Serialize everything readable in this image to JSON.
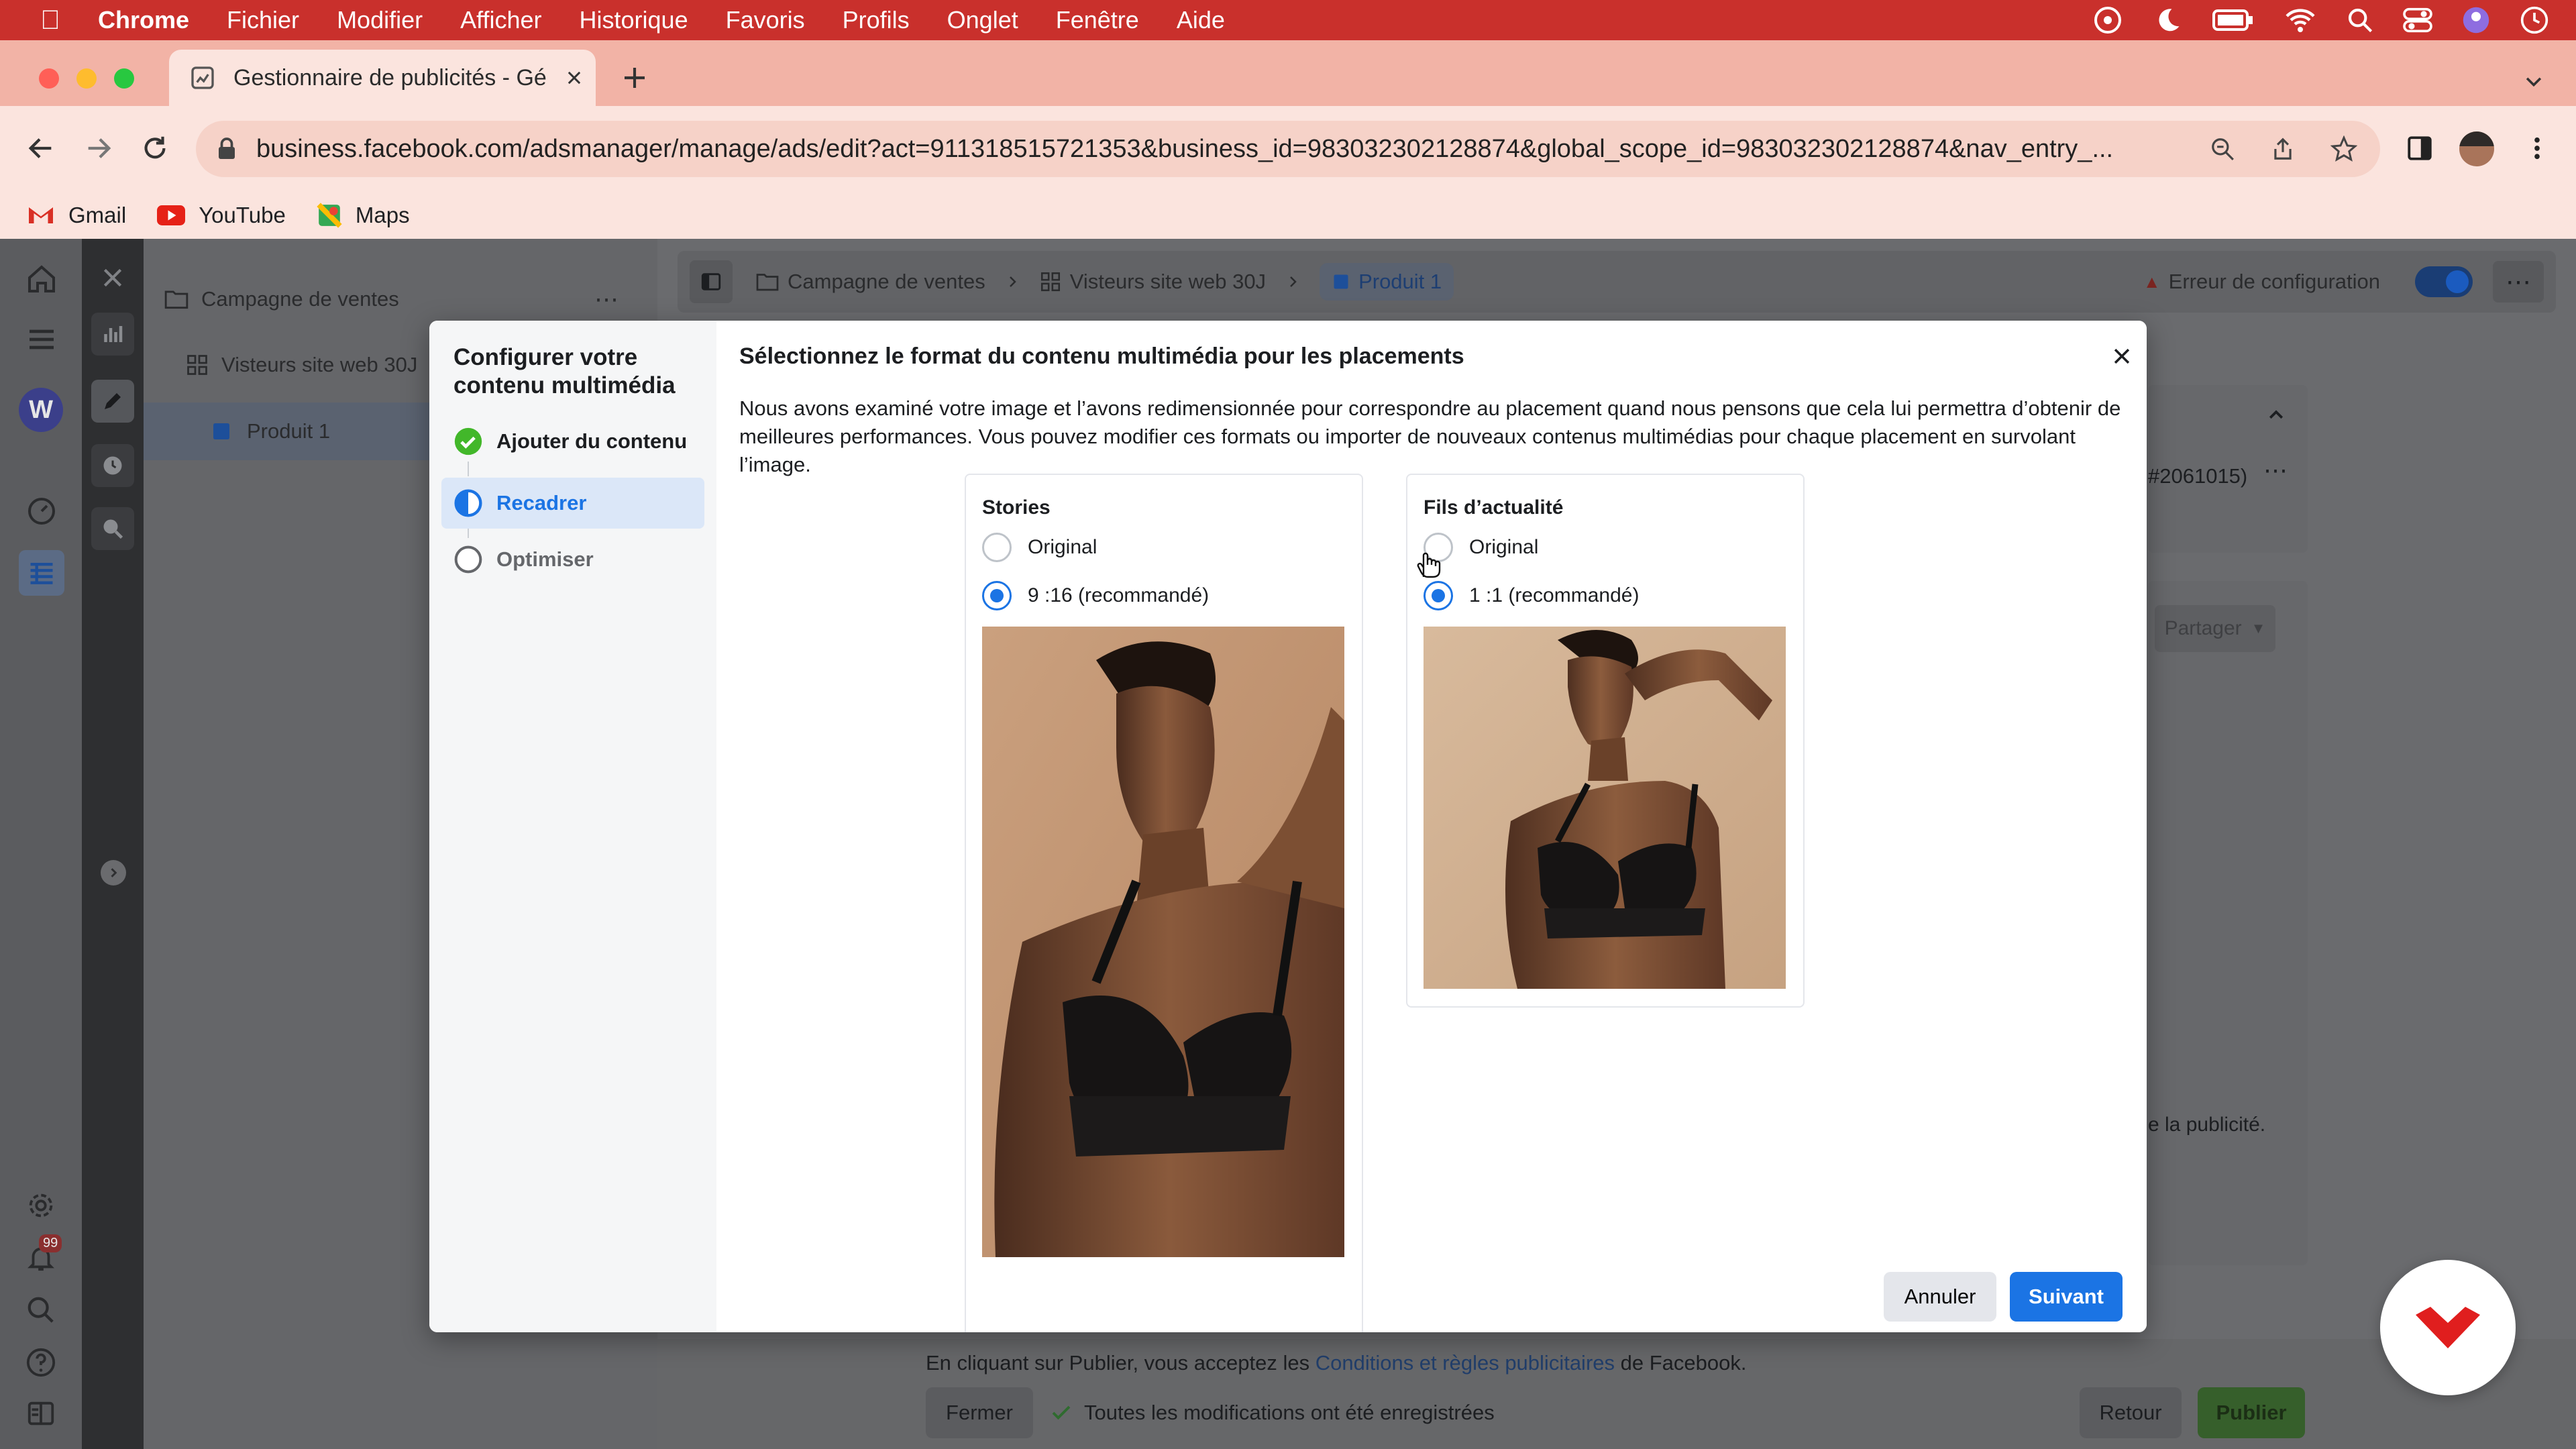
{
  "menubar": {
    "app": "Chrome",
    "items": [
      "Fichier",
      "Modifier",
      "Afficher",
      "Historique",
      "Favoris",
      "Profils",
      "Onglet",
      "Fenêtre",
      "Aide"
    ]
  },
  "browser": {
    "tab_title": "Gestionnaire de publicités - Gé",
    "url": "business.facebook.com/adsmanager/manage/ads/edit?act=911318515721353&business_id=983032302128874&global_scope_id=983032302128874&nav_entry_...",
    "bookmarks": [
      "Gmail",
      "YouTube",
      "Maps"
    ]
  },
  "tree": {
    "campaign": "Campagne de ventes",
    "adset": "Visteurs site web 30J",
    "ad": "Produit 1"
  },
  "breadcrumb": {
    "campaign": "Campagne de ventes",
    "adset": "Visteurs site web 30J",
    "ad": "Produit 1"
  },
  "status": {
    "error": "Erreur de configuration"
  },
  "background": {
    "id_fragment": "#2061015)",
    "share": "Partager",
    "note_fragment": "e la publicité.",
    "notification_count": "99"
  },
  "modal": {
    "sidebar_title": "Configurer votre contenu multimédia",
    "steps": [
      {
        "label": "Ajouter du contenu",
        "state": "done"
      },
      {
        "label": "Recadrer",
        "state": "current"
      },
      {
        "label": "Optimiser",
        "state": "todo"
      }
    ],
    "title": "Sélectionnez le format du contenu multimédia pour les placements",
    "description": "Nous avons examiné votre image et l’avons redimensionnée pour correspondre au placement quand nous pensons que cela lui permettra d’obtenir de meilleures performances. Vous pouvez modifier ces formats ou importer de nouveaux contenus multimédias pour chaque placement en survolant l’image.",
    "placements": [
      {
        "title": "Stories",
        "options": [
          "Original",
          "9 :16 (recommandé)"
        ],
        "selected": 1
      },
      {
        "title": "Fils d’actualité",
        "options": [
          "Original",
          "1 :1 (recommandé)"
        ],
        "selected": 1
      }
    ],
    "cancel": "Annuler",
    "next": "Suivant"
  },
  "footer": {
    "terms_prefix": "En cliquant sur Publier, vous acceptez les",
    "terms_link": "Conditions et règles publicitaires",
    "terms_suffix": "de Facebook.",
    "close": "Fermer",
    "saved": "Toutes les modifications ont été enregistrées",
    "back": "Retour",
    "publish": "Publier"
  },
  "colors": {
    "menubar": "#c9302c",
    "accent": "#1b74e4",
    "publish": "#42b72a"
  }
}
